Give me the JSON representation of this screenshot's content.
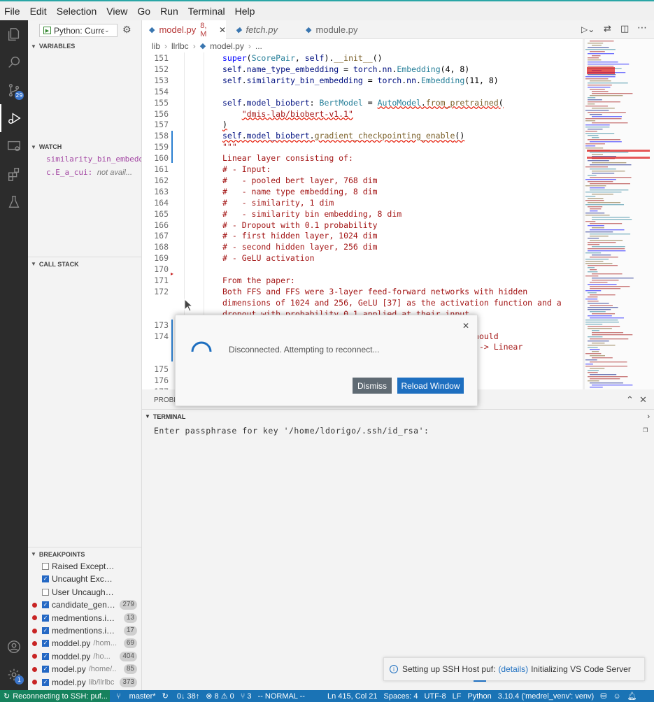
{
  "menu": [
    "File",
    "Edit",
    "Selection",
    "View",
    "Go",
    "Run",
    "Terminal",
    "Help"
  ],
  "activity_badges": {
    "scm": "29",
    "settings": "1"
  },
  "debug": {
    "config": "Python: Curre"
  },
  "sidebar": {
    "variables_title": "VARIABLES",
    "watch_title": "WATCH",
    "watch": [
      {
        "expr": "similarity_bin_embedd",
        "value": ""
      },
      {
        "expr": "c.E_a_cui:",
        "value": "not avail..."
      }
    ],
    "callstack_title": "CALL STACK",
    "breakpoints_title": "BREAKPOINTS",
    "breakpoints": [
      {
        "name": "Raised Exceptions",
        "checked": false,
        "dot": false,
        "path": "",
        "count": ""
      },
      {
        "name": "Uncaught Exceptions",
        "checked": true,
        "dot": false,
        "path": "",
        "count": ""
      },
      {
        "name": "User Uncaught Exce...",
        "checked": false,
        "dot": false,
        "path": "",
        "count": ""
      },
      {
        "name": "candidate_gene...",
        "checked": true,
        "dot": true,
        "path": "",
        "count": "279"
      },
      {
        "name": "medmentions.ip...",
        "checked": true,
        "dot": true,
        "path": "",
        "count": "13"
      },
      {
        "name": "medmentions.ip...",
        "checked": true,
        "dot": true,
        "path": "",
        "count": "17"
      },
      {
        "name": "moddel.py",
        "checked": true,
        "dot": true,
        "path": "/hom...",
        "count": "69"
      },
      {
        "name": "moddel.py",
        "checked": true,
        "dot": true,
        "path": "/ho...",
        "count": "404"
      },
      {
        "name": "model.py",
        "checked": true,
        "dot": true,
        "path": "/home/...",
        "count": "85"
      },
      {
        "name": "model.py",
        "checked": true,
        "dot": true,
        "path": "lib/llrlbc",
        "count": "373"
      }
    ]
  },
  "tabs": [
    {
      "label": "model.py",
      "badge": "8, M",
      "active": true
    },
    {
      "label": "fetch.py",
      "badge": "",
      "active": false
    },
    {
      "label": "module.py",
      "badge": "",
      "active": false
    }
  ],
  "breadcrumb": [
    "lib",
    "llrlbc",
    "model.py",
    "..."
  ],
  "editor_lines": [
    {
      "n": "151",
      "html": "<span class='kw'>super</span><span style='color:#000'>(</span><span class='cl'>ScorePair</span><span style='color:#000'>, </span><span class='pl'>self</span><span style='color:#000'>).</span><span class='fn'>__init__</span><span style='color:#000'>()</span>"
    },
    {
      "n": "152",
      "html": "<span class='pl'>self</span><span style='color:#000'>.</span><span class='pl'>name_type_embedding</span><span style='color:#000'> = </span><span class='pl'>torch</span><span style='color:#000'>.</span><span class='pl'>nn</span><span style='color:#000'>.</span><span class='cl'>Embedding</span><span style='color:#000'>(4, 8)</span>"
    },
    {
      "n": "153",
      "html": "<span class='pl'>self</span><span style='color:#000'>.</span><span class='pl'>similarity_bin_embedding</span><span style='color:#000'> = </span><span class='pl'>torch</span><span style='color:#000'>.</span><span class='pl'>nn</span><span style='color:#000'>.</span><span class='cl'>Embedding</span><span style='color:#000'>(11, 8)</span>"
    },
    {
      "n": "154",
      "html": ""
    },
    {
      "n": "155",
      "html": "<span class='pl'>self</span><span style='color:#000'>.</span><span class='pl'>model_biobert</span><span style='color:#000'>: </span><span class='cl'>BertModel</span><span style='color:#000'> = </span><span class='cl squig'>AutoModel</span><span class='squig' style='color:#000'>.</span><span class='fn squig'>from_pretrained</span><span class='squig' style='color:#000'>(</span>"
    },
    {
      "n": "156",
      "html": "    <span class='str squig'>\"dmis-lab/biobert-v1.1\"</span>"
    },
    {
      "n": "157",
      "html": "<span class='squig' style='color:#000'>)</span>"
    },
    {
      "n": "158",
      "html": "<span class='pl squig'>self</span><span class='squig' style='color:#000'>.</span><span class='pl squig'>model_biobert</span><span class='squig' style='color:#000'>.</span><span class='fn squig'>gradient_checkpointing_enable</span><span class='squig' style='color:#000'>()</span>"
    },
    {
      "n": "159",
      "html": "\"\"\""
    },
    {
      "n": "160",
      "html": "Linear layer consisting of:"
    },
    {
      "n": "161",
      "html": "# - Input:"
    },
    {
      "n": "162",
      "html": "#   - pooled bert layer, 768 dim"
    },
    {
      "n": "163",
      "html": "#   - name type embedding, 8 dim"
    },
    {
      "n": "164",
      "html": "#   - similarity, 1 dim"
    },
    {
      "n": "165",
      "html": "#   - similarity bin embedding, 8 dim"
    },
    {
      "n": "166",
      "html": "# - Dropout with 0.1 probability"
    },
    {
      "n": "167",
      "html": "# - first hidden layer, 1024 dim"
    },
    {
      "n": "168",
      "html": "# - second hidden layer, 256 dim"
    },
    {
      "n": "169",
      "html": "# - GeLU activation"
    },
    {
      "n": "170",
      "html": ""
    },
    {
      "n": "171",
      "html": "From the paper:"
    },
    {
      "n": "172",
      "html": "Both FFS and FFS were 3-layer feed-forward networks with hidden"
    },
    {
      "n": "",
      "html": "dimensions of 1024 and 256, GeLU [37] as the activation function and a"
    },
    {
      "n": "",
      "html": "dropout with probability 0.1 applied at their input."
    },
    {
      "n": "173",
      "html": ""
    },
    {
      "n": "174",
      "html": "                                          tructure should"
    },
    {
      "n": "",
      "html": "                                         ropout(0.1) -> Linear"
    },
    {
      "n": "",
      "html": "                                         )"
    },
    {
      "n": "175",
      "html": ""
    },
    {
      "n": "176",
      "html": ""
    },
    {
      "n": "177",
      "html": ""
    }
  ],
  "panel": {
    "problems_label": "PROBL",
    "terminal_title": "TERMINAL"
  },
  "terminal_text": "Enter passphrase for key '/home/ldorigo/.ssh/id_rsa':",
  "dialog": {
    "message": "Disconnected. Attempting to reconnect...",
    "dismiss": "Dismiss",
    "reload": "Reload Window"
  },
  "notification": {
    "prefix": "Setting up SSH Host puf:",
    "link": "(details)",
    "suffix": "Initializing VS Code Server"
  },
  "statusbar": {
    "remote": "Reconnecting to SSH: puf...",
    "branch": "master*",
    "sync": "0↓ 38↑",
    "problems": "⊗ 8 ⚠ 0",
    "ports": "⑂ 3",
    "mode": "-- NORMAL --",
    "position": "Ln 415, Col 21",
    "spaces": "Spaces: 4",
    "encoding": "UTF-8",
    "eol": "LF",
    "language": "Python",
    "interpreter": "3.10.4 ('medrel_venv': venv)"
  }
}
